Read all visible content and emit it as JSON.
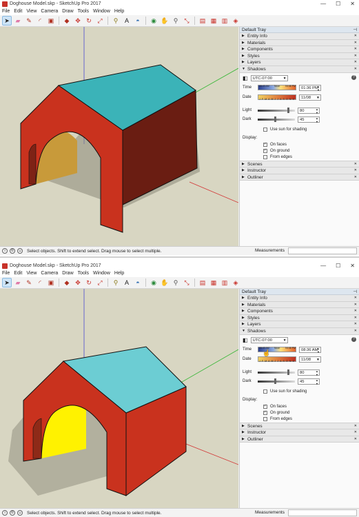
{
  "colors": {
    "wall_red": "#c9321e",
    "wall_red_dark": "#6a1d12",
    "roof_cyan": "#3bb3b8",
    "roof_cyan_light": "#6ccdd3",
    "ground": "#d8d6c2",
    "inside_dim": "#c89a3a",
    "inside_bright": "#fff200",
    "axis_green": "#2fb52f",
    "axis_red": "#d23232",
    "axis_blue": "#4a4ad0"
  },
  "window_top": {
    "title": "Doghouse Model.skp - SketchUp Pro 2017",
    "menu": [
      "File",
      "Edit",
      "View",
      "Camera",
      "Draw",
      "Tools",
      "Window",
      "Help"
    ],
    "tray_title": "Default Tray",
    "sections_top": [
      "Entity Info",
      "Materials",
      "Components",
      "Styles",
      "Layers"
    ],
    "shadows_label": "Shadows",
    "timezone": "UTC-07:00",
    "time_label": "Time",
    "time_scale_start": "06:43 AM",
    "time_scale_mid": "Noon",
    "time_scale_end": "04:46 PM",
    "time_value": "01:36 PM",
    "date_label": "Date",
    "date_months": "J F M A M J J A S O N D",
    "date_value": "11/08",
    "light_label": "Light",
    "light_value": "80",
    "light_level": 0.8,
    "dark_label": "Dark",
    "dark_value": "45",
    "dark_level": 0.45,
    "use_sun_label": "Use sun for shading",
    "use_sun_checked": false,
    "display_label": "Display:",
    "on_faces_label": "On faces",
    "on_faces_checked": true,
    "on_ground_label": "On ground",
    "on_ground_checked": true,
    "from_edges_label": "From edges",
    "from_edges_checked": false,
    "sections_bottom": [
      "Scenes",
      "Instructor",
      "Outliner"
    ],
    "status_text": "Select objects. Shift to extend select. Drag mouse to select multiple.",
    "measurements_label": "Measurements"
  },
  "window_bottom": {
    "title": "Doghouse Model.skp - SketchUp Pro 2017",
    "menu": [
      "File",
      "Edit",
      "View",
      "Camera",
      "Draw",
      "Tools",
      "Window",
      "Help"
    ],
    "tray_title": "Default Tray",
    "sections_top": [
      "Entity Info",
      "Materials",
      "Components",
      "Styles",
      "Layers"
    ],
    "shadows_label": "Shadows",
    "timezone": "UTC-07:00",
    "time_label": "Time",
    "time_scale_start": "06:43 AM",
    "time_scale_mid": "Noon",
    "time_scale_end": "04:46 PM",
    "time_value": "08:36 AM",
    "date_label": "Date",
    "date_months": "J F M A M J J A S O N D",
    "date_value": "11/08",
    "light_label": "Light",
    "light_value": "80",
    "light_level": 0.8,
    "dark_label": "Dark",
    "dark_value": "45",
    "dark_level": 0.45,
    "use_sun_label": "Use sun for shading",
    "use_sun_checked": false,
    "display_label": "Display:",
    "on_faces_label": "On faces",
    "on_faces_checked": true,
    "on_ground_label": "On ground",
    "on_ground_checked": true,
    "from_edges_label": "From edges",
    "from_edges_checked": false,
    "sections_bottom": [
      "Scenes",
      "Instructor",
      "Outliner"
    ],
    "status_text": "Select objects. Shift to extend select. Drag mouse to select multiple.",
    "measurements_label": "Measurements"
  },
  "toolbar_icons": [
    "select-icon",
    "eraser-icon",
    "pencil-icon",
    "arc-icon",
    "shape-icon",
    "push-pull-icon",
    "move-icon",
    "rotate-icon",
    "scale-icon",
    "tape-measure-icon",
    "text-icon",
    "paint-bucket-icon",
    "orbit-icon",
    "pan-icon",
    "zoom-icon",
    "zoom-extents-icon",
    "warehouse-icon",
    "extension-warehouse-icon",
    "layout-icon",
    "ruby-icon"
  ]
}
